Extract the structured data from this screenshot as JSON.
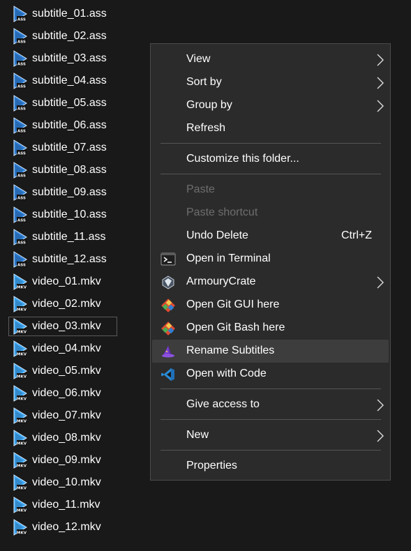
{
  "files": [
    {
      "name": "subtitle_01.ass",
      "type": "ass"
    },
    {
      "name": "subtitle_02.ass",
      "type": "ass"
    },
    {
      "name": "subtitle_03.ass",
      "type": "ass"
    },
    {
      "name": "subtitle_04.ass",
      "type": "ass"
    },
    {
      "name": "subtitle_05.ass",
      "type": "ass"
    },
    {
      "name": "subtitle_06.ass",
      "type": "ass"
    },
    {
      "name": "subtitle_07.ass",
      "type": "ass"
    },
    {
      "name": "subtitle_08.ass",
      "type": "ass"
    },
    {
      "name": "subtitle_09.ass",
      "type": "ass"
    },
    {
      "name": "subtitle_10.ass",
      "type": "ass"
    },
    {
      "name": "subtitle_11.ass",
      "type": "ass"
    },
    {
      "name": "subtitle_12.ass",
      "type": "ass"
    },
    {
      "name": "video_01.mkv",
      "type": "mkv"
    },
    {
      "name": "video_02.mkv",
      "type": "mkv"
    },
    {
      "name": "video_03.mkv",
      "type": "mkv",
      "selected": true
    },
    {
      "name": "video_04.mkv",
      "type": "mkv"
    },
    {
      "name": "video_05.mkv",
      "type": "mkv"
    },
    {
      "name": "video_06.mkv",
      "type": "mkv"
    },
    {
      "name": "video_07.mkv",
      "type": "mkv"
    },
    {
      "name": "video_08.mkv",
      "type": "mkv"
    },
    {
      "name": "video_09.mkv",
      "type": "mkv"
    },
    {
      "name": "video_10.mkv",
      "type": "mkv"
    },
    {
      "name": "video_11.mkv",
      "type": "mkv"
    },
    {
      "name": "video_12.mkv",
      "type": "mkv"
    }
  ],
  "file_icon_badges": {
    "ass": "ASS",
    "mkv": "MKV"
  },
  "menu": {
    "view": "View",
    "sort_by": "Sort by",
    "group_by": "Group by",
    "refresh": "Refresh",
    "customize": "Customize this folder...",
    "paste": "Paste",
    "paste_shortcut": "Paste shortcut",
    "undo_delete": "Undo Delete",
    "undo_delete_shortcut": "Ctrl+Z",
    "open_terminal": "Open in Terminal",
    "armoury_crate": "ArmouryCrate",
    "open_git_gui": "Open Git GUI here",
    "open_git_bash": "Open Git Bash here",
    "rename_subtitles": "Rename Subtitles",
    "open_with_code": "Open with Code",
    "give_access": "Give access to",
    "new": "New",
    "properties": "Properties"
  },
  "colors": {
    "background": "#191919",
    "menu_bg": "#2b2b2b",
    "hover": "#3d3d3d",
    "disabled_text": "#6e6e6e",
    "vscode_blue": "#2a8ad4",
    "git_red": "#e04b32",
    "play_icon": "#2f7fd6"
  }
}
